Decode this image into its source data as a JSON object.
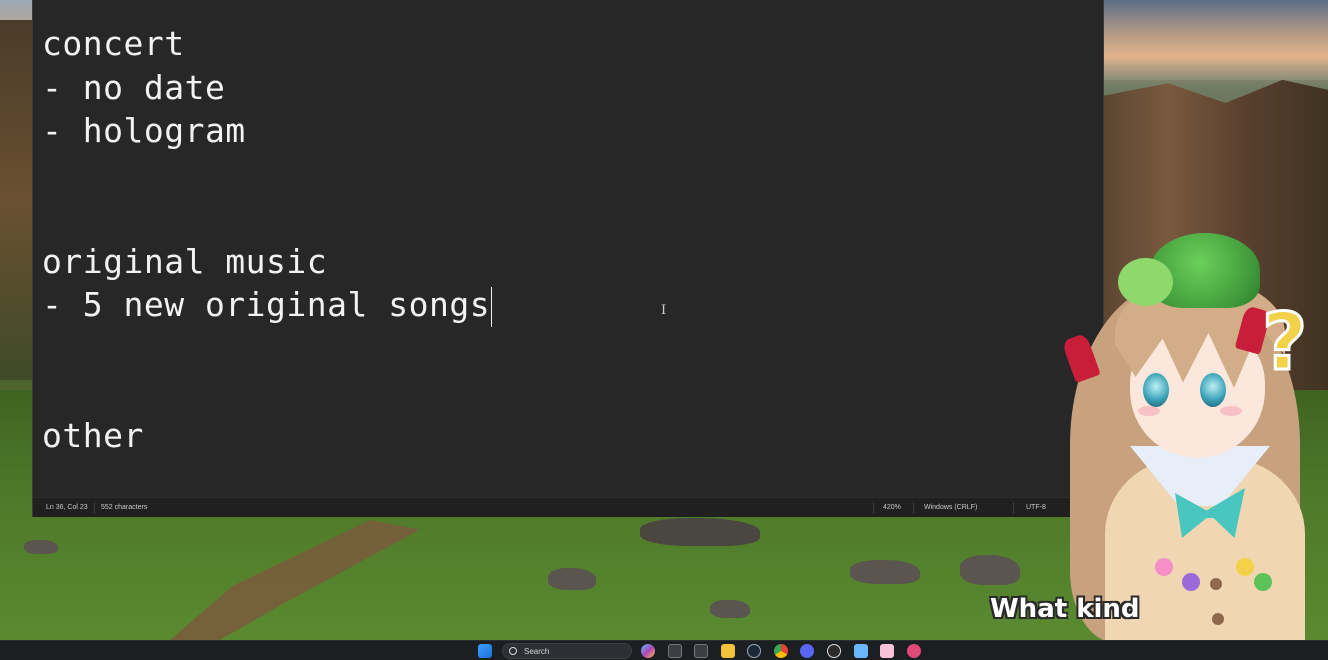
{
  "editor": {
    "lines": [
      "concert",
      "- no date",
      "- hologram",
      "",
      "",
      "original music",
      "- 5 new original songs",
      "",
      "",
      "other"
    ]
  },
  "statusbar": {
    "position": "Ln 36, Col 23",
    "char_count": "552 characters",
    "zoom": "420%",
    "line_ending": "Windows (CRLF)",
    "encoding": "UTF-8"
  },
  "overlay": {
    "caption": "What kind",
    "question_mark": "?"
  },
  "taskbar": {
    "search_label": "Search",
    "icons": [
      "windows-start-icon",
      "search-icon",
      "copilot-icon",
      "terminal-icon",
      "terminal-icon",
      "file-explorer-icon",
      "steam-icon",
      "chrome-icon",
      "discord-icon",
      "obs-icon",
      "notepad-icon",
      "app-icon",
      "app-icon"
    ]
  },
  "colors": {
    "editor_bg": "#272727",
    "editor_text": "#f2f2f2",
    "statusbar_bg": "#202020",
    "taskbar_bg": "#1c1f22",
    "caption_text": "#ffffff"
  }
}
